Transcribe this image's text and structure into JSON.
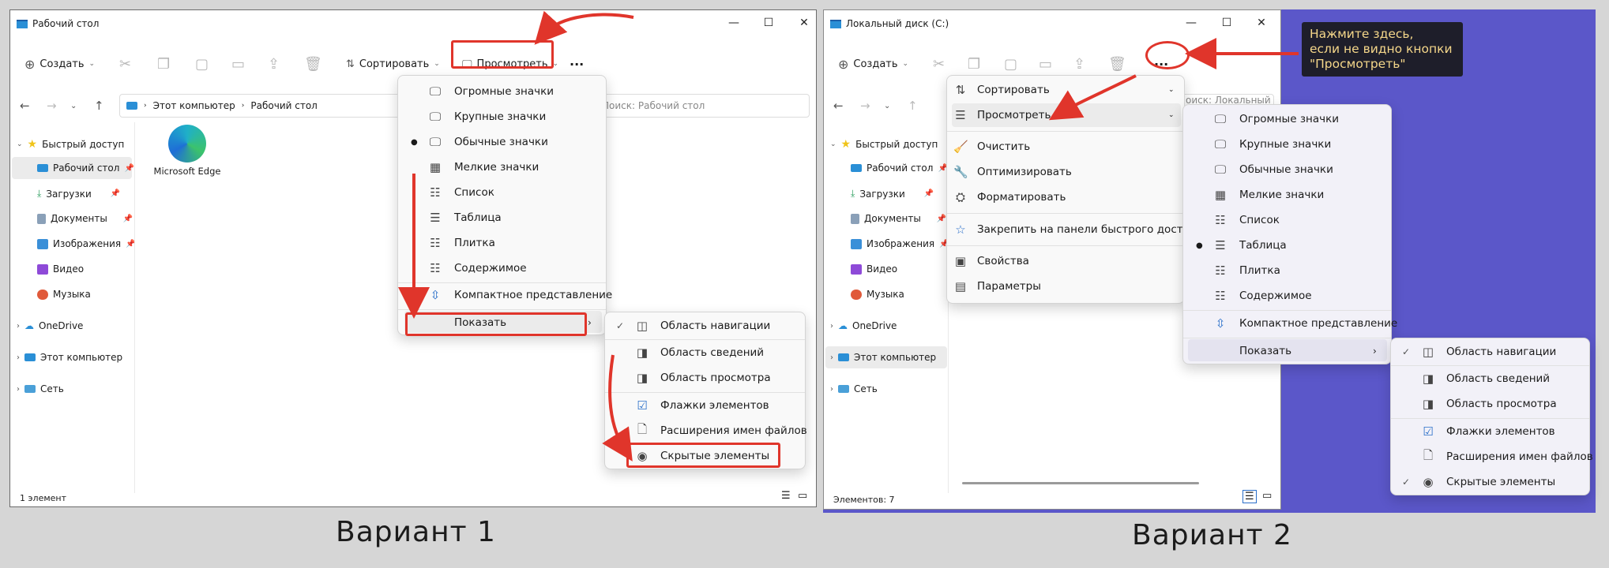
{
  "left": {
    "title": "Рабочий стол",
    "toolbar": {
      "create": "Создать",
      "sort": "Сортировать",
      "view": "Просмотреть",
      "more": "···"
    },
    "breadcrumb": [
      "Этот компьютер",
      "Рабочий стол"
    ],
    "search_placeholder": "Поиск: Рабочий стол",
    "sidebar": [
      "Быстрый доступ",
      "Рабочий стол",
      "Загрузки",
      "Документы",
      "Изображения",
      "Видео",
      "Музыка",
      "OneDrive",
      "Этот компьютер",
      "Сеть"
    ],
    "desktop_icon": "Microsoft Edge",
    "status": "1 элемент",
    "view_menu": [
      "Огромные значки",
      "Крупные значки",
      "Обычные значки",
      "Мелкие значки",
      "Список",
      "Таблица",
      "Плитка",
      "Содержимое",
      "Компактное представление",
      "Показать"
    ],
    "show_menu": [
      "Область навигации",
      "Область сведений",
      "Область просмотра",
      "Флажки элементов",
      "Расширения имен файлов",
      "Скрытые элементы"
    ],
    "caption": "Вариант 1"
  },
  "right": {
    "title": "Локальный диск (C:)",
    "toolbar": {
      "create": "Создать",
      "more": "···"
    },
    "search_placeholder": "Поиск: Локальный диск (C:)",
    "sidebar": [
      "Быстрый доступ",
      "Рабочий стол",
      "Загрузки",
      "Документы",
      "Изображения",
      "Видео",
      "Музыка",
      "OneDrive",
      "Этот компьютер",
      "Сеть"
    ],
    "status": "Элементов: 7",
    "more_menu": [
      "Сортировать",
      "Просмотреть",
      "Очистить",
      "Оптимизировать",
      "Форматировать",
      "Закрепить на панели быстрого доступа",
      "Свойства",
      "Параметры"
    ],
    "view_menu": [
      "Огромные значки",
      "Крупные значки",
      "Обычные значки",
      "Мелкие значки",
      "Список",
      "Таблица",
      "Плитка",
      "Содержимое",
      "Компактное представление",
      "Показать"
    ],
    "show_menu": [
      "Область навигации",
      "Область сведений",
      "Область просмотра",
      "Флажки элементов",
      "Расширения имен файлов",
      "Скрытые элементы"
    ],
    "callout": [
      "Нажмите здесь,",
      "если не видно кнопки",
      "\"Просмотреть\""
    ],
    "caption": "Вариант 2"
  },
  "colors": {
    "accent": "#e0352b",
    "desktop_bg": "#5b57c9",
    "callout_text": "#f5d78a"
  },
  "icons": [
    "search-icon",
    "pin-icon",
    "star-icon",
    "folder-icon",
    "check-icon",
    "chevron-right-icon",
    "eye-icon"
  ]
}
